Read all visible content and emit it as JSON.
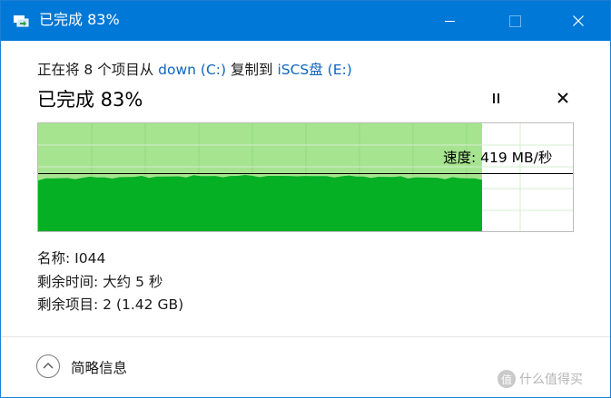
{
  "window": {
    "title": "已完成 83%",
    "controls": {
      "minimize": "minimize",
      "maximize": "maximize",
      "close": "close"
    }
  },
  "copy": {
    "prefix": "正在将 8 个项目从",
    "source": "down (C:)",
    "middle": "复制到",
    "destination": "iSCS盘 (E:)"
  },
  "progress": {
    "label": "已完成 83%",
    "fraction": 0.83
  },
  "graph": {
    "speed_label": "速度: 419 MB/秒",
    "colors": {
      "completed_area": "#a6e48f",
      "speed_fill": "#06b025",
      "grid": "#d4eed0",
      "border": "#bcbcbc"
    }
  },
  "details": {
    "name_label": "名称:",
    "name_value": "I044",
    "time_label": "剩余时间:",
    "time_value": "大约 5 秒",
    "items_label": "剩余项目:",
    "items_value": "2 (1.42 GB)"
  },
  "footer": {
    "collapse_label": "简略信息"
  },
  "watermark": {
    "text": "什么值得买",
    "logo": "值"
  },
  "colors": {
    "titlebar": "#0078d7",
    "link": "#1065c0"
  },
  "icons": {
    "app": "file-copy-icon",
    "pause": "pause-icon",
    "cancel": "close-icon",
    "collapse": "chevron-up-icon"
  }
}
